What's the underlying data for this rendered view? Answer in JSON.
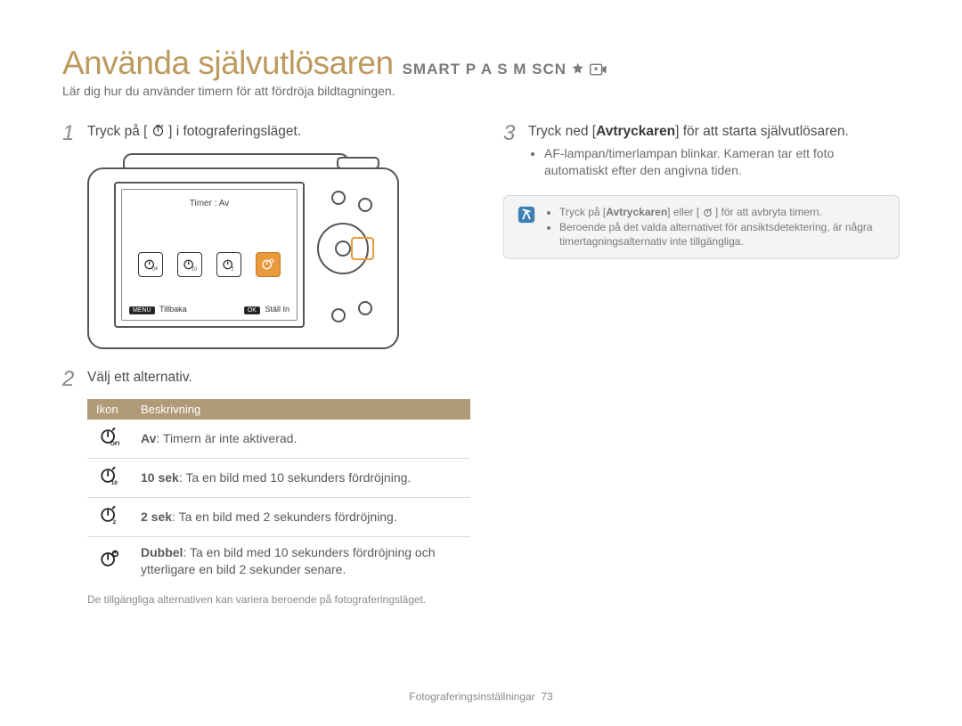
{
  "title": {
    "main": "Använda självutlösaren",
    "modes": "SMART P A S M SCN"
  },
  "subtitle": "Lär dig hur du använder timern för att fördröja bildtagningen.",
  "icons": {
    "timer": "timer-icon",
    "star_filled": "star-filled-icon",
    "video_star": "video-star-icon",
    "info": "info-icon"
  },
  "left": {
    "step1": {
      "num": "1",
      "pre": "Tryck på [",
      "post": "] i fotograferingsläget."
    },
    "camera_screen": {
      "title": "Timer : Av",
      "back_key": "MENU",
      "back_label": "Tillbaka",
      "ok_key": "OK",
      "ok_label": "Ställ In"
    },
    "step2": {
      "num": "2",
      "text": "Välj ett alternativ."
    },
    "table": {
      "headers": {
        "icon": "Ikon",
        "desc": "Beskrivning"
      },
      "rows": [
        {
          "icon": "timer-off-icon",
          "sub": "OFF",
          "bold": "Av",
          "text": ": Timern är inte aktiverad."
        },
        {
          "icon": "timer-10-icon",
          "sub": "10",
          "bold": "10 sek",
          "text": ": Ta en bild med 10 sekunders fördröjning."
        },
        {
          "icon": "timer-2-icon",
          "sub": "2",
          "bold": "2 sek",
          "text": ": Ta en bild med 2 sekunders fördröjning."
        },
        {
          "icon": "timer-double-icon",
          "sub": "",
          "bold": "Dubbel",
          "text": ": Ta en bild med 10 sekunders fördröjning och ytterligare en bild 2 sekunder senare."
        }
      ]
    },
    "footnote": "De tillgängliga alternativen kan variera beroende på fotograferingsläget."
  },
  "right": {
    "step3": {
      "num": "3",
      "pre": "Tryck ned [",
      "bold": "Avtryckaren",
      "post": "] för att starta självutlösaren.",
      "bullets": [
        "AF-lampan/timerlampan blinkar. Kameran tar ett foto automatiskt efter den angivna tiden."
      ]
    },
    "info": {
      "line1_pre": "Tryck på [",
      "line1_bold": "Avtryckaren",
      "line1_mid": "] eller [",
      "line1_post": "] för att avbryta timern.",
      "line2": "Beroende på det valda alternativet för ansiktsdetektering, är några timertagningsalternativ inte tillgängliga."
    }
  },
  "footer": {
    "section": "Fotograferingsinställningar",
    "page": "73"
  }
}
